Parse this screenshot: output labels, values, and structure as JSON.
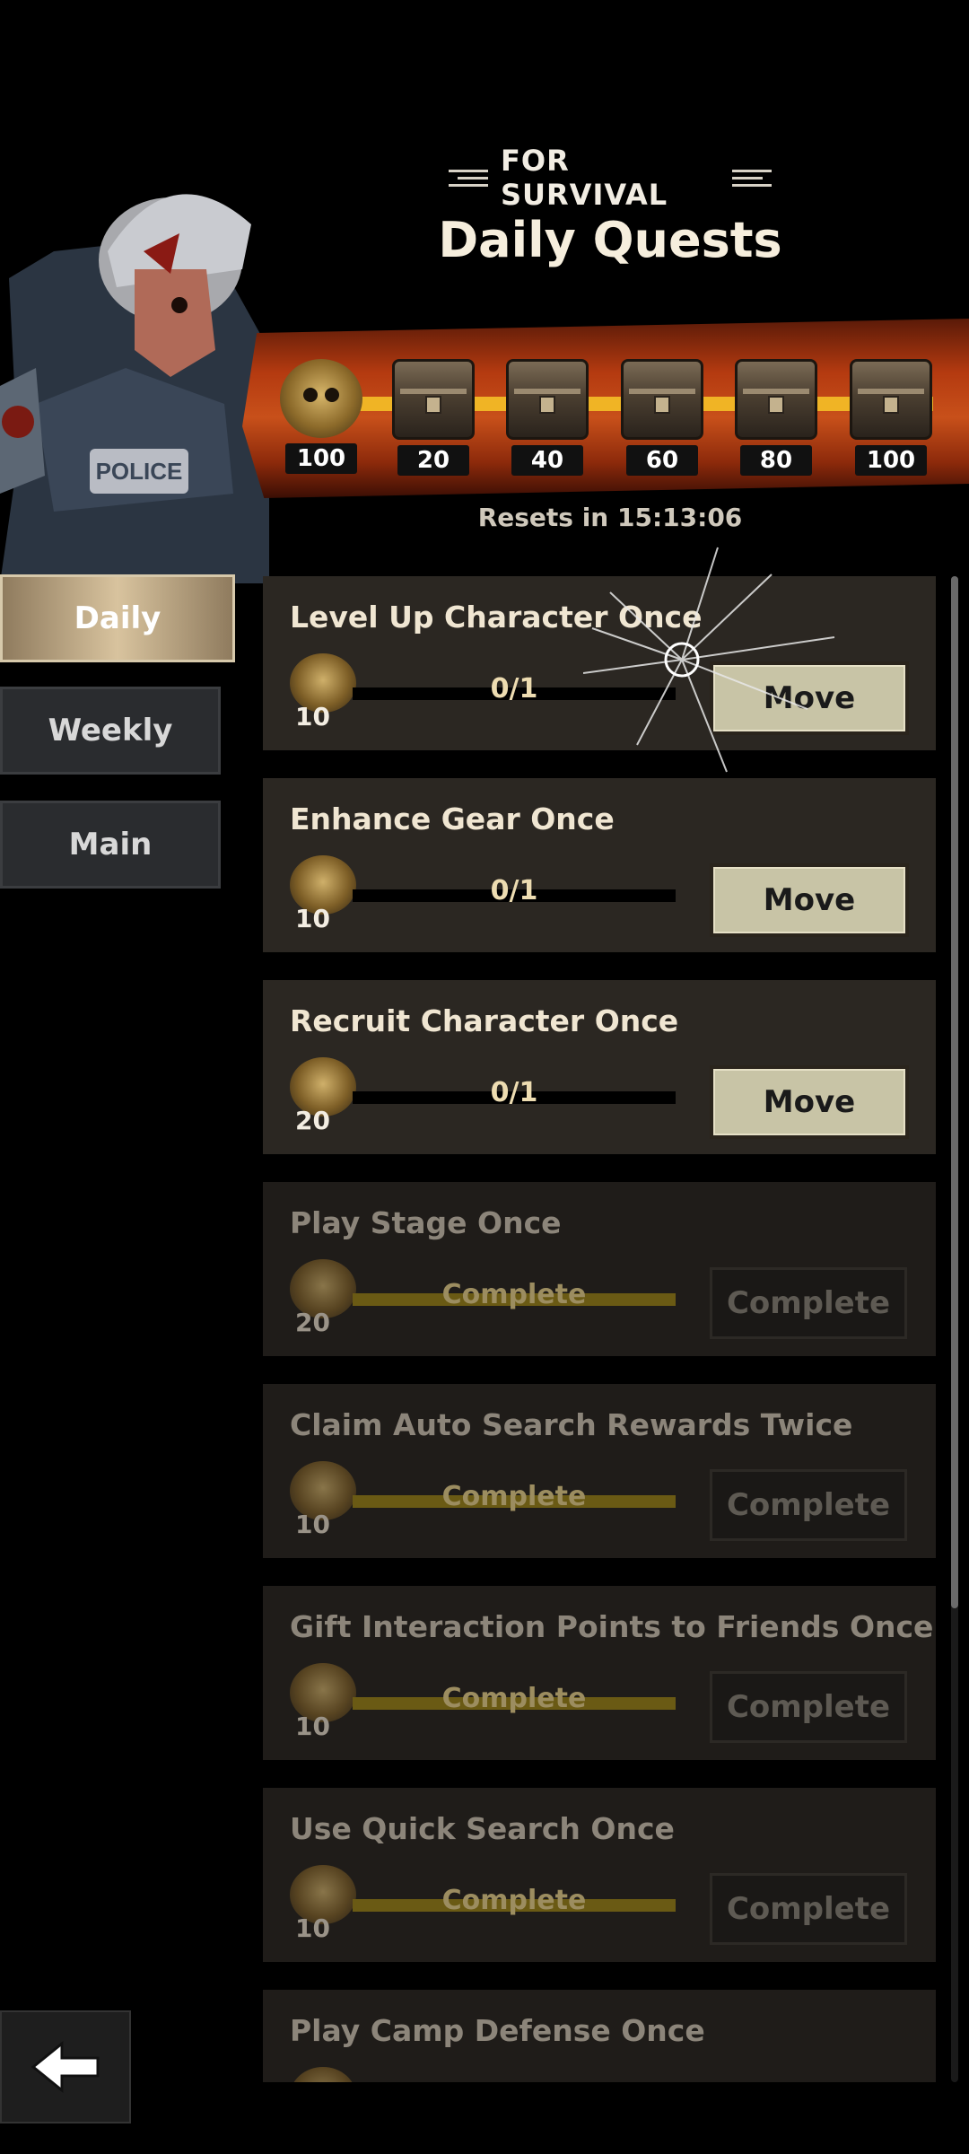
{
  "header": {
    "subtitle": "FOR SURVIVAL",
    "title": "Daily Quests"
  },
  "rewards": {
    "milestones": [
      {
        "label": "100",
        "icon": "skull-medal-icon"
      },
      {
        "label": "20",
        "icon": "chest-icon"
      },
      {
        "label": "40",
        "icon": "chest-icon"
      },
      {
        "label": "60",
        "icon": "chest-icon"
      },
      {
        "label": "80",
        "icon": "chest-icon"
      },
      {
        "label": "100",
        "icon": "chest-icon"
      }
    ],
    "resets": "Resets in 15:13:06"
  },
  "tabs": [
    {
      "label": "Daily",
      "active": true
    },
    {
      "label": "Weekly",
      "active": false
    },
    {
      "label": "Main",
      "active": false
    }
  ],
  "quests": [
    {
      "title": "Level Up Character Once",
      "reward": "10",
      "progress": "0/1",
      "button": "Move",
      "done": false
    },
    {
      "title": "Enhance Gear Once",
      "reward": "10",
      "progress": "0/1",
      "button": "Move",
      "done": false
    },
    {
      "title": "Recruit Character Once",
      "reward": "20",
      "progress": "0/1",
      "button": "Move",
      "done": false
    },
    {
      "title": "Play Stage Once",
      "reward": "20",
      "progress": "Complete",
      "button": "Complete",
      "done": true
    },
    {
      "title": "Claim Auto Search Rewards Twice",
      "reward": "10",
      "progress": "Complete",
      "button": "Complete",
      "done": true
    },
    {
      "title": "Gift Interaction Points to Friends Once",
      "reward": "10",
      "progress": "Complete",
      "button": "Complete",
      "done": true
    },
    {
      "title": "Use Quick Search Once",
      "reward": "10",
      "progress": "Complete",
      "button": "Complete",
      "done": true
    },
    {
      "title": "Play Camp Defense Once",
      "reward": "",
      "progress": "",
      "button": "",
      "done": true
    }
  ],
  "colors": {
    "accent": "#f0b425",
    "banner": "#c8501a",
    "move_button": "#c8c4a6"
  }
}
